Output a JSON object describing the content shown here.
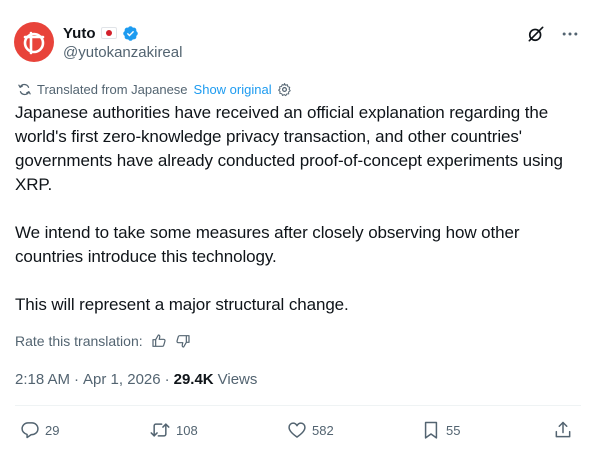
{
  "author": {
    "display_name": "Yuto",
    "handle": "@yutokanzakireal"
  },
  "translation": {
    "label": "Translated from Japanese",
    "show_original": "Show original",
    "rate_label": "Rate this translation:"
  },
  "tweet": {
    "text": "Japanese authorities have received an official explanation regarding the world's first zero-knowledge privacy transaction, and other countries' governments have already conducted proof-of-concept experiments using XRP.\n\nWe intend to take some measures after closely observing how other countries introduce this technology.\n\nThis will represent a major structural change."
  },
  "meta": {
    "time": "2:18 AM",
    "separator": "·",
    "date": "Apr 1, 2026",
    "views_count": "29.4K",
    "views_label": "Views"
  },
  "actions": {
    "replies": "29",
    "reposts": "108",
    "likes": "582",
    "bookmarks": "55"
  },
  "colors": {
    "accent": "#1d9bf0",
    "avatar": "#e8433a",
    "muted": "#536471",
    "text": "#0f1419"
  },
  "icons": [
    "verified-badge-icon",
    "grok-icon",
    "more-icon",
    "translate-icon",
    "settings-icon",
    "thumbs-up-icon",
    "thumbs-down-icon",
    "reply-icon",
    "repost-icon",
    "like-icon",
    "bookmark-icon",
    "share-icon"
  ]
}
